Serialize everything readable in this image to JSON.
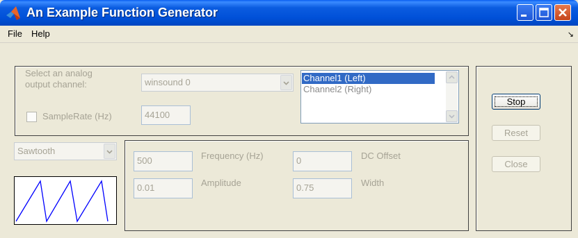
{
  "window": {
    "title": "An Example Function Generator",
    "icon": "matlab-logo-icon"
  },
  "menu": {
    "items": [
      {
        "label": "File"
      },
      {
        "label": "Help"
      }
    ],
    "overflow_icon": "toolbar-toggle-icon"
  },
  "channel": {
    "select_label_line1": "Select an analog",
    "select_label_line2": "output channel:",
    "device_value": "winsound 0",
    "samplerate_label": "SampleRate (Hz)",
    "samplerate_checked": false,
    "samplerate_value": "44100",
    "list": [
      {
        "label": "Channel1 (Left)",
        "selected": true
      },
      {
        "label": "Channel2 (Right)",
        "selected": false
      }
    ]
  },
  "waveform": {
    "type_value": "Sawtooth",
    "frequency_value": "500",
    "frequency_label": "Frequency (Hz)",
    "dc_offset_value": "0",
    "dc_offset_label": "DC Offset",
    "amplitude_value": "0.01",
    "amplitude_label": "Amplitude",
    "width_value": "0.75",
    "width_label": "Width"
  },
  "buttons": {
    "stop_label": "Stop",
    "reset_label": "Reset",
    "close_label": "Close"
  },
  "colors": {
    "titlebar": "#0054e3",
    "selection": "#316ac5",
    "disabled_text": "#a6a395",
    "waveform_line": "#0000ff"
  }
}
